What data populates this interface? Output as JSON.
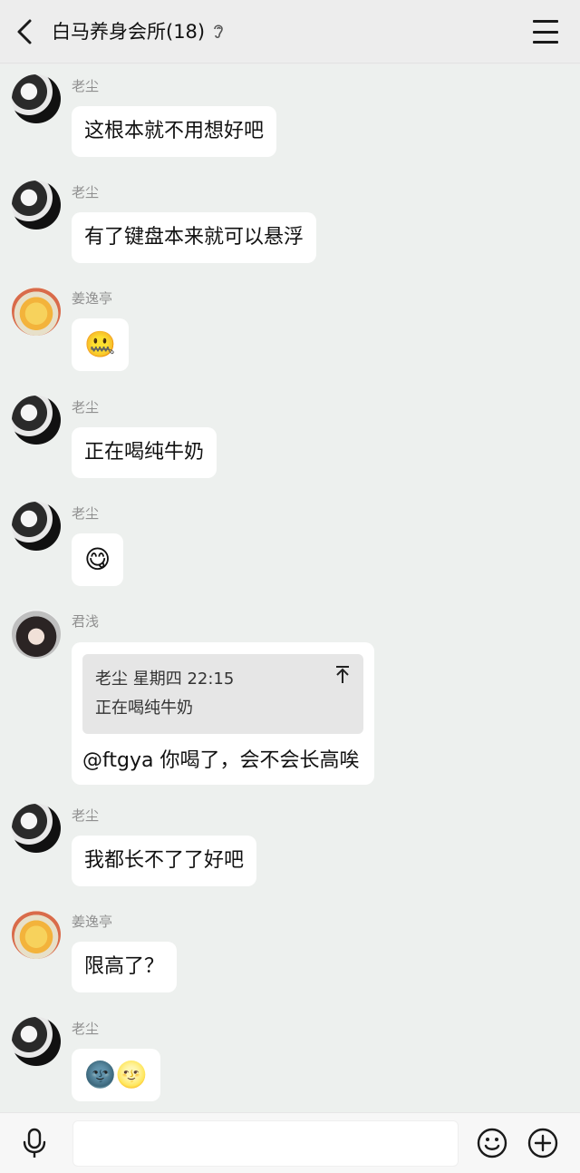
{
  "header": {
    "title": "白马养身会所(18)",
    "back_icon": "chevron-left-icon",
    "ear_icon": "ear-icon",
    "menu_icon": "menu-icon"
  },
  "messages": [
    {
      "sender": "老尘",
      "text": "这根本就不用想好吧",
      "avatar": "avatar-dark"
    },
    {
      "sender": "老尘",
      "text": "有了键盘本来就可以悬浮",
      "avatar": "avatar-dark"
    },
    {
      "sender": "姜逸亭",
      "text": "🤐",
      "avatar": "avatar-yellow"
    },
    {
      "sender": "老尘",
      "text": "正在喝纯牛奶",
      "avatar": "avatar-dark"
    },
    {
      "sender": "老尘",
      "text": "😋",
      "avatar": "avatar-dark"
    },
    {
      "sender": "君浅",
      "avatar": "avatar-girl",
      "quote": {
        "meta": "老尘 星期四 22:15",
        "text": "正在喝纯牛奶"
      },
      "text": "@ftgya 你喝了，会不会长高唉"
    },
    {
      "sender": "老尘",
      "text": "我都长不了了好吧",
      "avatar": "avatar-dark"
    },
    {
      "sender": "姜逸亭",
      "text": "限高了？",
      "avatar": "avatar-yellow"
    },
    {
      "sender": "老尘",
      "text": "🌚🌝",
      "avatar": "avatar-dark"
    }
  ],
  "input_bar": {
    "voice_icon": "microphone-icon",
    "emoji_icon": "smiley-icon",
    "more_icon": "plus-circle-icon",
    "input_value": ""
  }
}
